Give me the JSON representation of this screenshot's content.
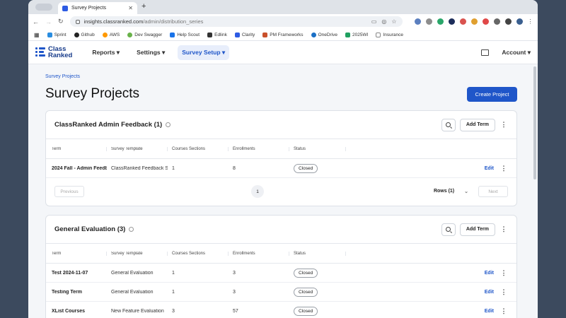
{
  "browser": {
    "tab_title": "Survey Projects",
    "url_domain": "insights.classranked.com",
    "url_path": "/admin/distribution_series",
    "bookmarks": [
      {
        "label": "Sprint",
        "color": "#2a8de0"
      },
      {
        "label": "Github",
        "color": "#222222"
      },
      {
        "label": "AWS",
        "color": "#ff9900"
      },
      {
        "label": "Dev Swagger",
        "color": "#69b24a"
      },
      {
        "label": "Help Scout",
        "color": "#1a73e8"
      },
      {
        "label": "Edlink",
        "color": "#333333"
      },
      {
        "label": "Clarity",
        "color": "#2d5be3"
      },
      {
        "label": "PM Frameworks",
        "color": "#c9502b"
      },
      {
        "label": "OneDrive",
        "color": "#1b6fc5"
      },
      {
        "label": "2025WI",
        "color": "#20a060"
      },
      {
        "label": "Insurance",
        "color": "#888888"
      }
    ]
  },
  "app": {
    "logo_line1": "Class",
    "logo_line2": "Ranked",
    "menu": [
      {
        "label": "Reports ▾"
      },
      {
        "label": "Settings ▾"
      },
      {
        "label": "Survey Setup ▾"
      }
    ],
    "account_label": "Account ▾",
    "brand_color": "#1f56c9"
  },
  "page": {
    "breadcrumb": "Survey Projects",
    "title": "Survey Projects",
    "create_button": "Create Project"
  },
  "cards": [
    {
      "title": "ClassRanked Admin Feedback (1)",
      "add_term": "Add Term",
      "headers": [
        "Term",
        "Survey Template",
        "Courses Sections",
        "Enrollments",
        "Status"
      ],
      "rows": [
        {
          "term": "2024 Fall - Admin Feedb",
          "template": "ClassRanked Feedback S",
          "sections": "1",
          "enrollments": "8",
          "status": "Closed",
          "edit": "Edit"
        }
      ],
      "pager": {
        "previous": "Previous",
        "page": "1",
        "rows": "Rows (1)",
        "next": "Next"
      }
    },
    {
      "title": "General Evaluation (3)",
      "add_term": "Add Term",
      "headers": [
        "Term",
        "Survey Template",
        "Courses Sections",
        "Enrollments",
        "Status"
      ],
      "rows": [
        {
          "term": "Test 2024-11-07",
          "template": "General Evaluation",
          "sections": "1",
          "enrollments": "3",
          "status": "Closed",
          "edit": "Edit"
        },
        {
          "term": "Testing Term",
          "template": "General Evaluation",
          "sections": "1",
          "enrollments": "3",
          "status": "Closed",
          "edit": "Edit"
        },
        {
          "term": "XList Courses",
          "template": "New Feature Evaluation",
          "sections": "3",
          "enrollments": "57",
          "status": "Closed",
          "edit": "Edit"
        }
      ]
    }
  ]
}
